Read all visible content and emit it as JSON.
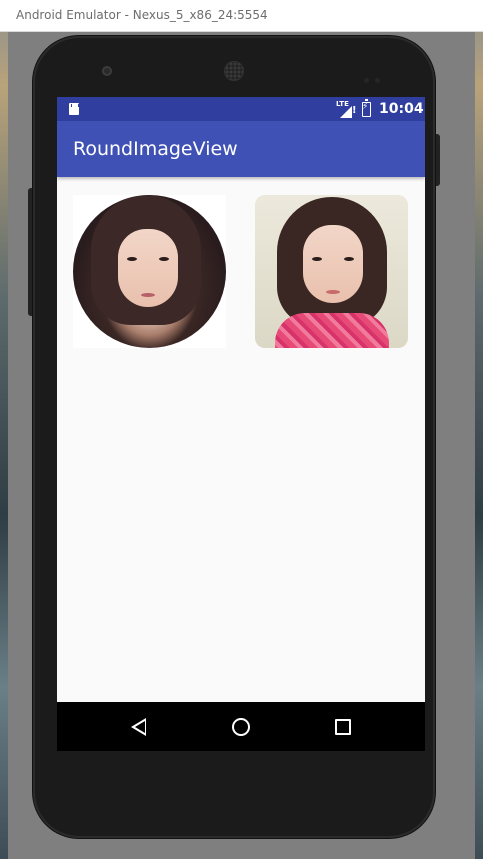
{
  "window": {
    "title": "Android Emulator - Nexus_5_x86_24:5554"
  },
  "status_bar": {
    "network_label": "LTE",
    "time": "10:04",
    "icons": [
      "sd-card-icon",
      "signal-icon",
      "battery-charging-icon"
    ],
    "color": "#303f9f"
  },
  "app_bar": {
    "title": "RoundImageView",
    "color": "#3f51b5"
  },
  "content": {
    "images": [
      {
        "shape": "circle",
        "description_icon": "portrait-photo"
      },
      {
        "shape": "rounded-rect",
        "description_icon": "portrait-photo"
      }
    ]
  },
  "nav_bar": {
    "buttons": [
      "back-icon",
      "home-icon",
      "recent-apps-icon"
    ]
  }
}
